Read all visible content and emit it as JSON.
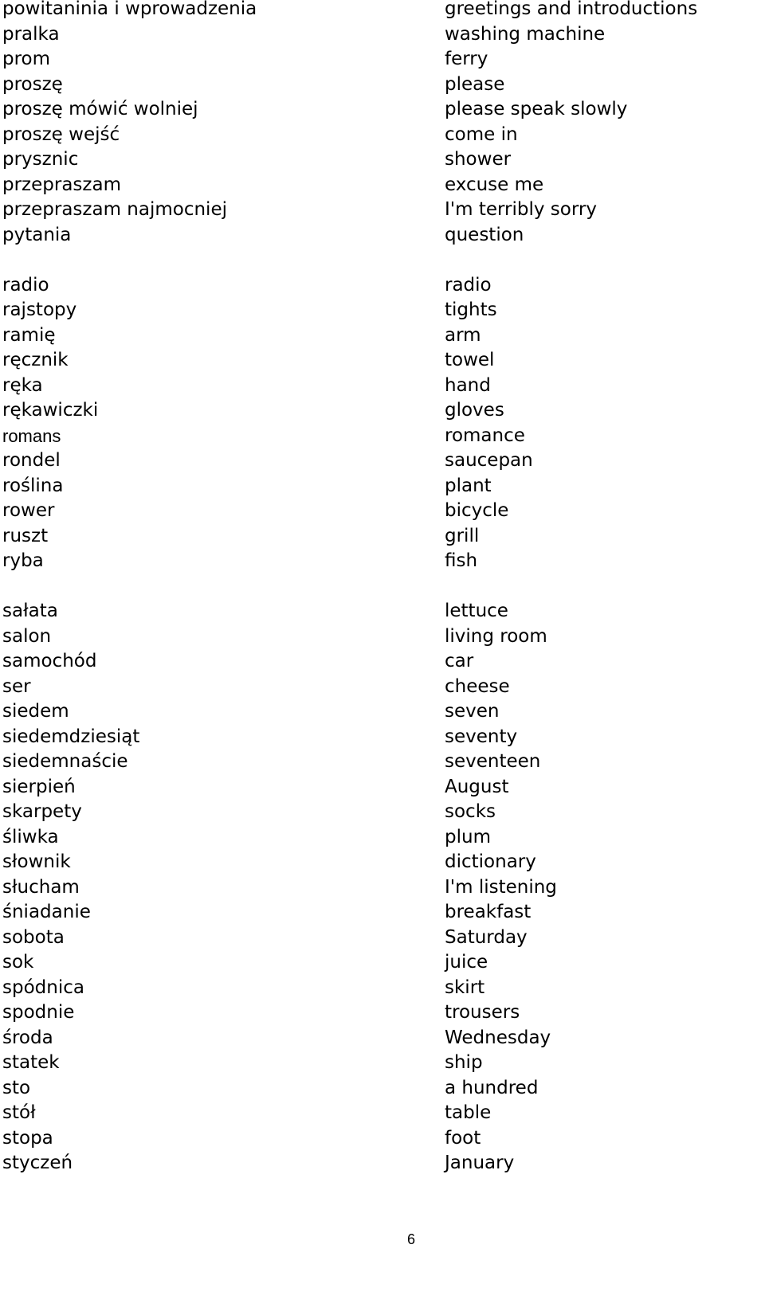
{
  "groups": [
    [
      {
        "pl": "powitaninia i wprowadzenia",
        "en": "greetings and introductions"
      },
      {
        "pl": "pralka",
        "en": "washing machine"
      },
      {
        "pl": "prom",
        "en": "ferry"
      },
      {
        "pl": "proszę",
        "en": "please"
      },
      {
        "pl": "proszę mówić wolniej",
        "en": "please speak slowly"
      },
      {
        "pl": "proszę wejść",
        "en": "come in"
      },
      {
        "pl": "prysznic",
        "en": "shower"
      },
      {
        "pl": "przepraszam",
        "en": "excuse me"
      },
      {
        "pl": "przepraszam najmocniej",
        "en": "I'm terribly sorry"
      },
      {
        "pl": "pytania",
        "en": "question"
      }
    ],
    [
      {
        "pl": "radio",
        "en": "radio"
      },
      {
        "pl": "rajstopy",
        "en": "tights"
      },
      {
        "pl": "ramię",
        "en": "arm"
      },
      {
        "pl": "ręcznik",
        "en": "towel"
      },
      {
        "pl": "ręka",
        "en": "hand"
      },
      {
        "pl": "rękawiczki",
        "en": "gloves"
      },
      {
        "pl": "romans",
        "en": "romance"
      },
      {
        "pl": "rondel",
        "en": "saucepan"
      },
      {
        "pl": "roślina",
        "en": "plant"
      },
      {
        "pl": "rower",
        "en": "bicycle"
      },
      {
        "pl": "ruszt",
        "en": "grill"
      },
      {
        "pl": "ryba",
        "en": "fish"
      }
    ],
    [
      {
        "pl": "sałata",
        "en": "lettuce"
      },
      {
        "pl": "salon",
        "en": "living room"
      },
      {
        "pl": "samochód",
        "en": "car"
      },
      {
        "pl": "ser",
        "en": "cheese"
      },
      {
        "pl": "siedem",
        "en": "seven"
      },
      {
        "pl": "siedemdziesiąt",
        "en": "seventy"
      },
      {
        "pl": "siedemnaście",
        "en": "seventeen"
      },
      {
        "pl": "sierpień",
        "en": "August"
      },
      {
        "pl": "skarpety",
        "en": "socks"
      },
      {
        "pl": "śliwka",
        "en": "plum"
      },
      {
        "pl": "słownik",
        "en": "dictionary"
      },
      {
        "pl": "słucham",
        "en": "I'm listening"
      },
      {
        "pl": "śniadanie",
        "en": "breakfast"
      },
      {
        "pl": "sobota",
        "en": "Saturday"
      },
      {
        "pl": "sok",
        "en": "juice"
      },
      {
        "pl": "spódnica",
        "en": "skirt"
      },
      {
        "pl": "spodnie",
        "en": "trousers"
      },
      {
        "pl": "środa",
        "en": "Wednesday"
      },
      {
        "pl": "statek",
        "en": "ship"
      },
      {
        "pl": "sto",
        "en": "a hundred"
      },
      {
        "pl": "stół",
        "en": "table"
      },
      {
        "pl": "stopa",
        "en": "foot"
      },
      {
        "pl": "styczeń",
        "en": "January"
      }
    ]
  ],
  "page_number": "6"
}
